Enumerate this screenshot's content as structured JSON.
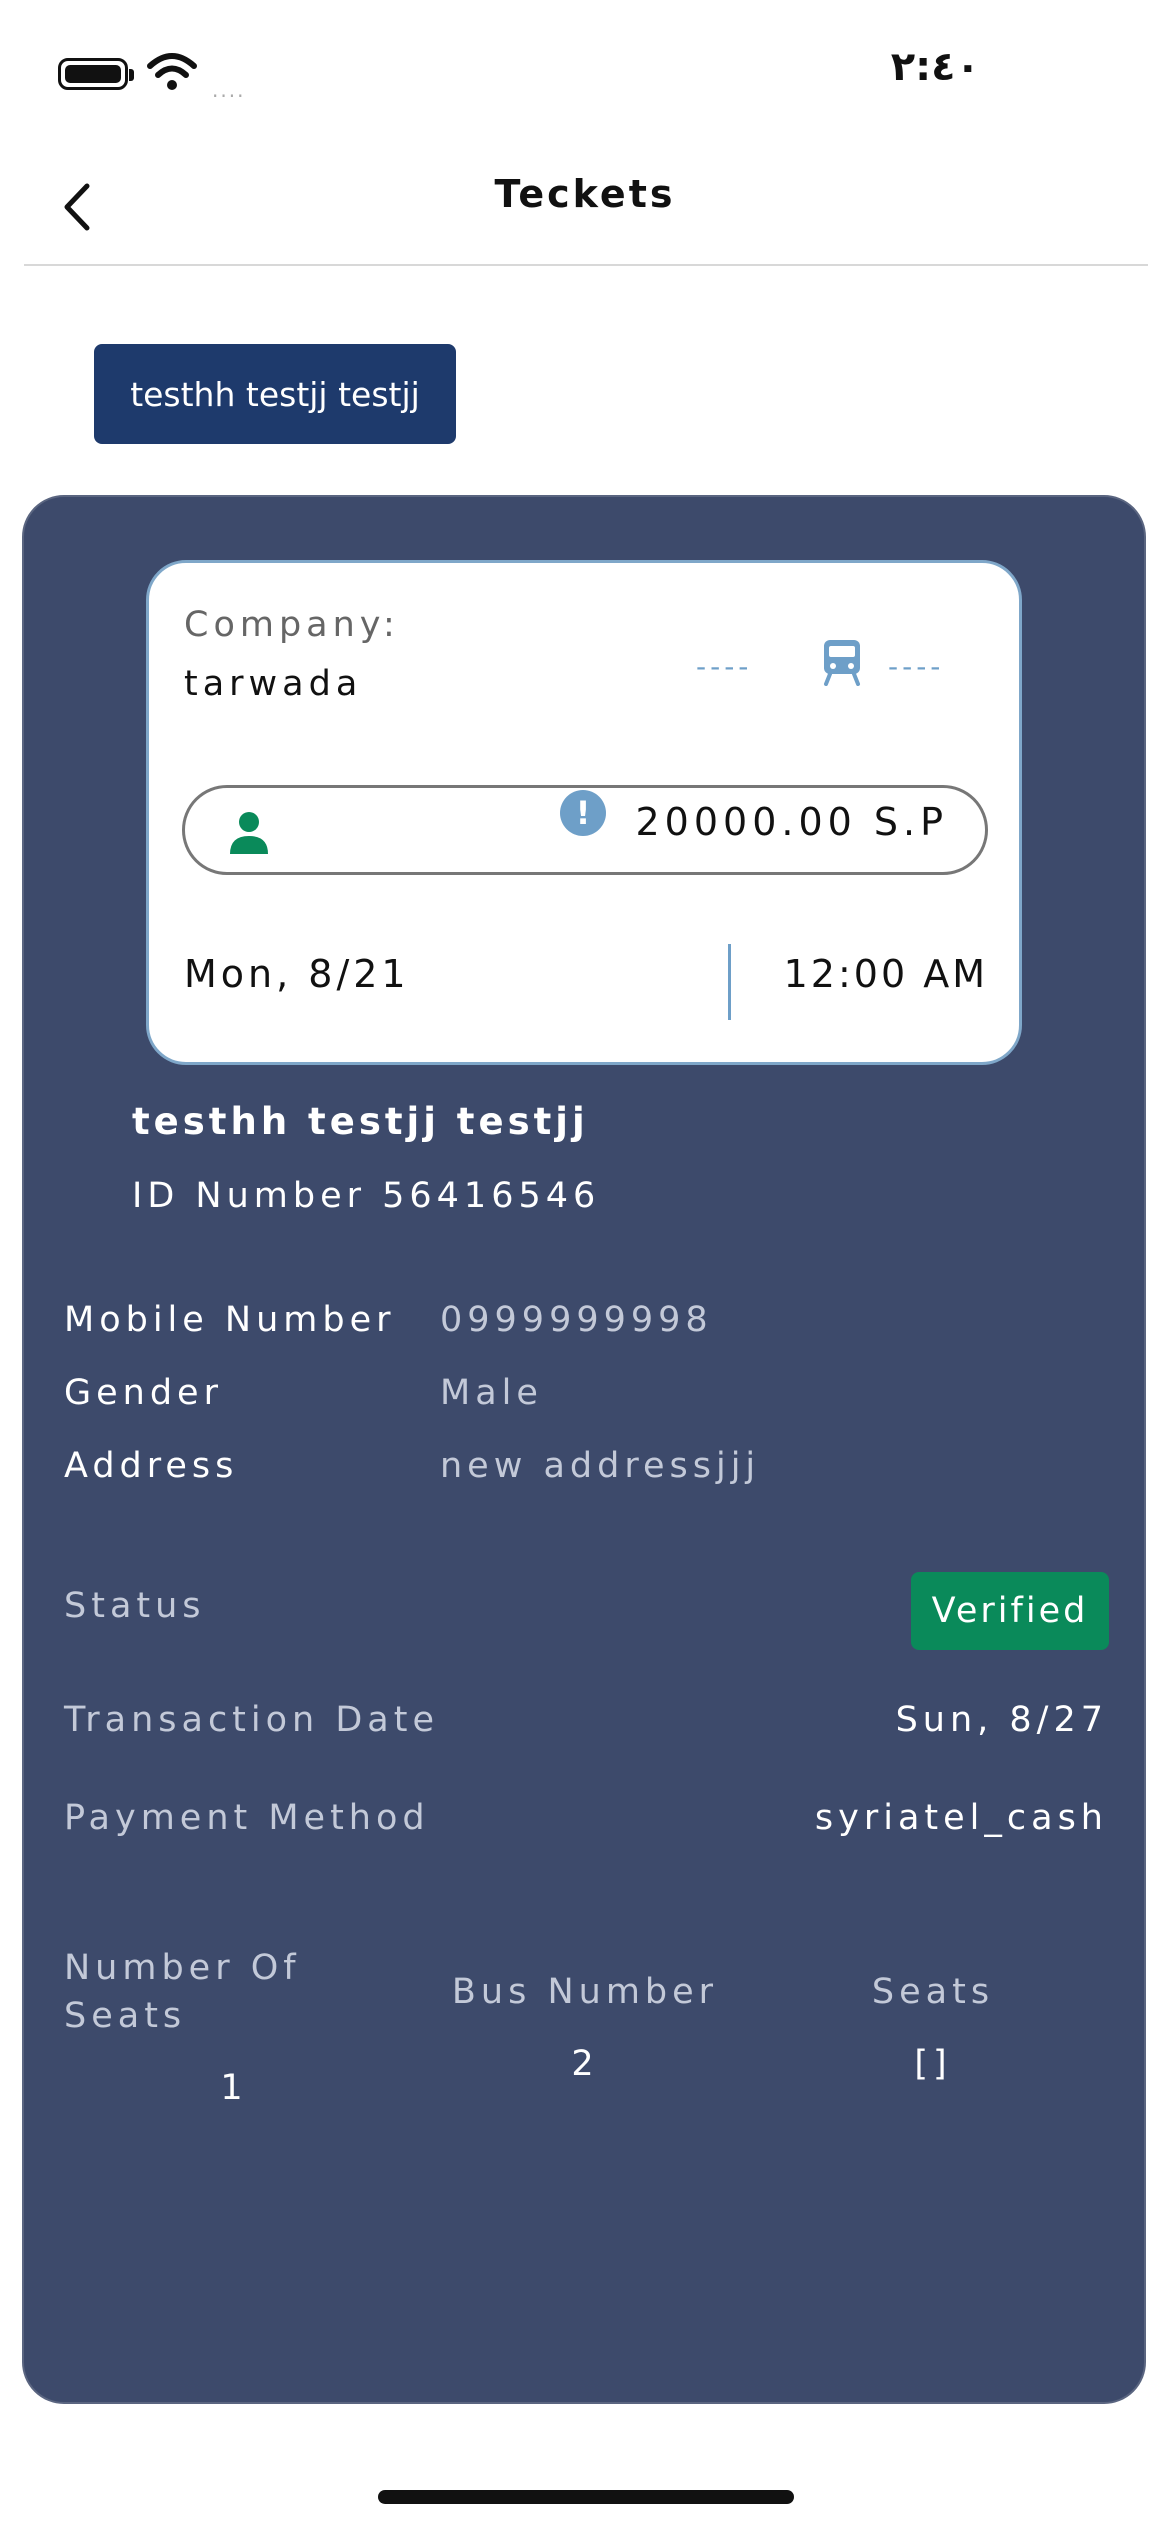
{
  "status_bar": {
    "time": "٢:٤٠",
    "signal": "...."
  },
  "header": {
    "title": "Teckets"
  },
  "passenger_chip": {
    "label": "testhh testjj testjj"
  },
  "ticket": {
    "company_label": "Company:",
    "company_name": "tarwada",
    "route_dash_left": "----",
    "route_dash_right": "----",
    "price": "20000.00 S.P",
    "info_mark": "!",
    "date": "Mon, 8/21",
    "time": "12:00 AM"
  },
  "passenger": {
    "name": "testhh testjj testjj",
    "id_line": "ID Number 56416546",
    "mobile_label": "Mobile Number",
    "mobile_value": "0999999998",
    "gender_label": "Gender",
    "gender_value": "Male",
    "address_label": "Address",
    "address_value": "new addressjjj"
  },
  "transaction": {
    "status_label": "Status",
    "status_value": "Verified",
    "date_label": "Transaction Date",
    "date_value": "Sun, 8/27",
    "payment_label": "Payment Method",
    "payment_value": "syriatel_cash"
  },
  "seats_info": {
    "num_seats_label_1": "Number Of",
    "num_seats_label_2": "Seats",
    "num_seats_value": "1",
    "bus_number_label": "Bus Number",
    "bus_number_value": "2",
    "seats_label": "Seats",
    "seats_value": "[]"
  },
  "colors": {
    "primary": "#1e3a6c",
    "card_bg": "#3d4a6b",
    "accent_blue": "#6e9fc8",
    "verified_green": "#0a8a5a",
    "person_icon_green": "#0a8a5a"
  },
  "icons": [
    "battery-icon",
    "wifi-icon",
    "back-chevron-icon",
    "bus-icon",
    "person-icon",
    "info-icon"
  ]
}
